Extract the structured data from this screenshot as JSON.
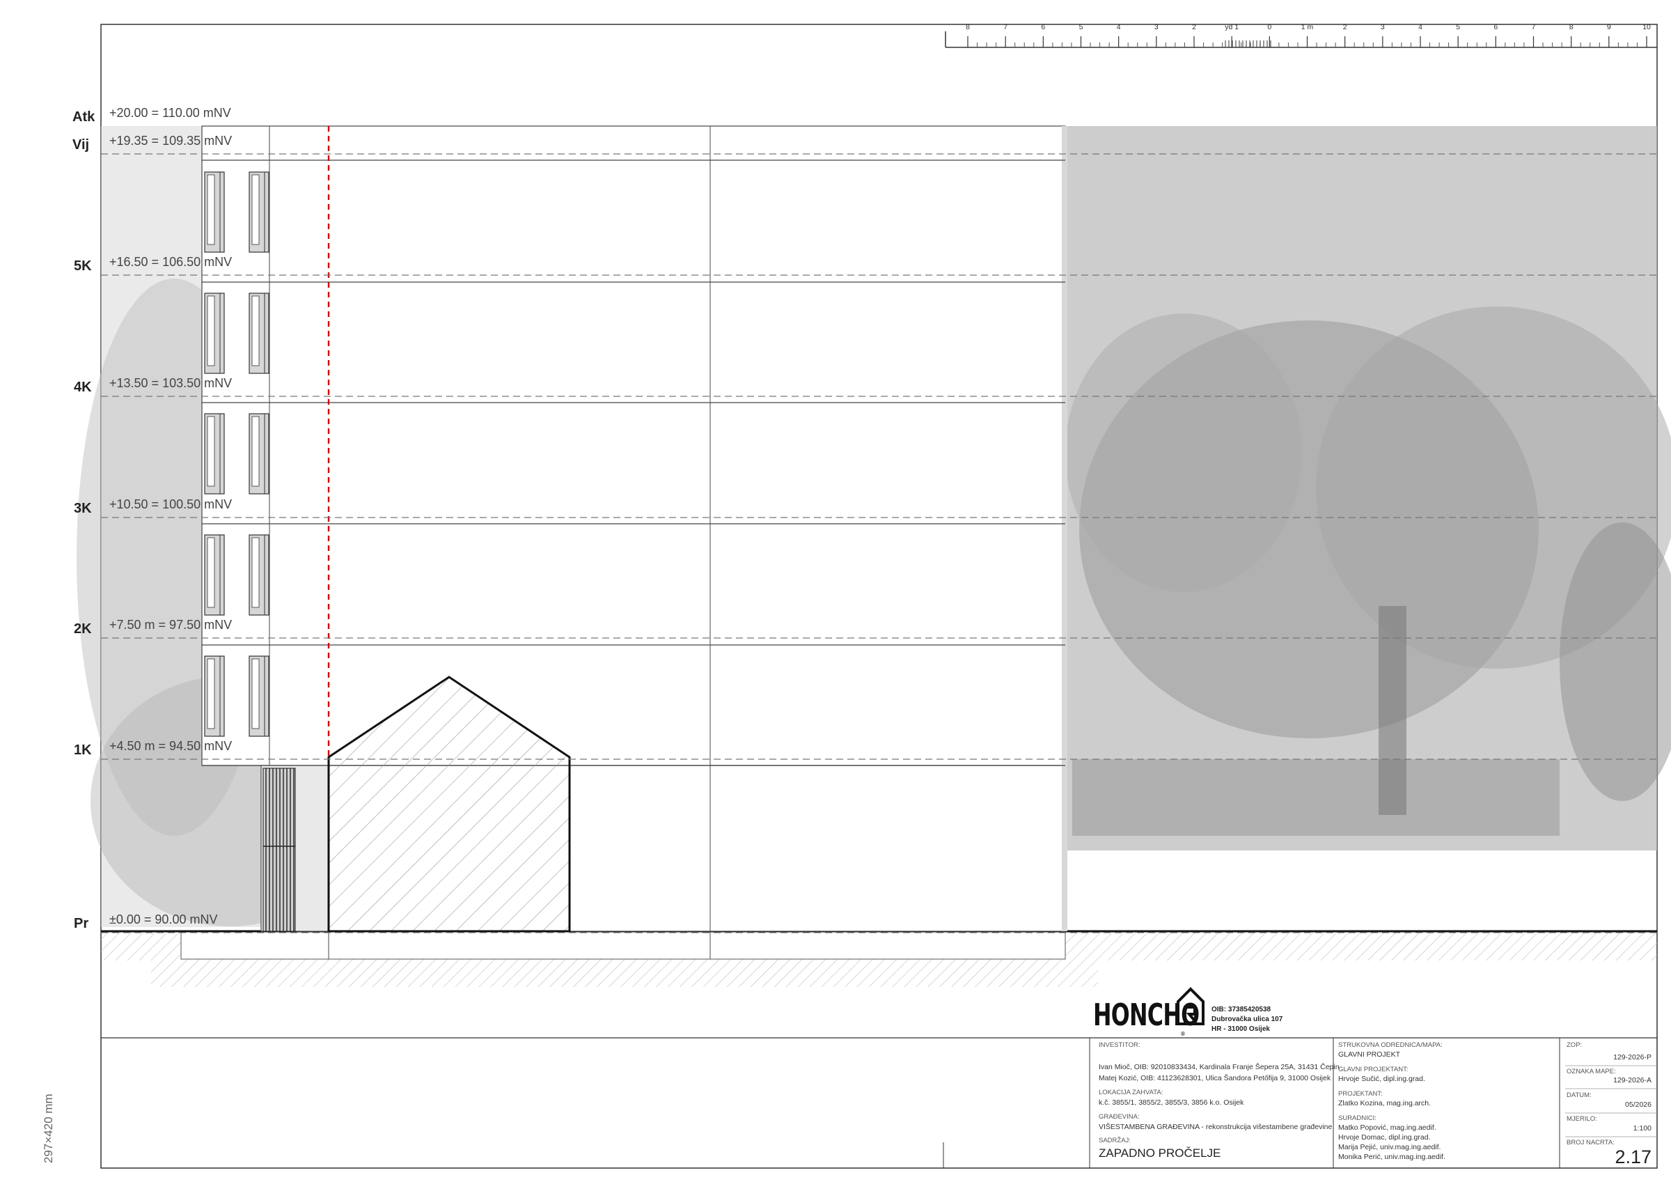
{
  "scale_bar": {
    "ticks": [
      "8",
      "7",
      "6",
      "5",
      "4",
      "3",
      "2",
      "yd 1",
      "0",
      "1 m",
      "2",
      "3",
      "4",
      "5",
      "6",
      "7",
      "8",
      "9",
      "10"
    ]
  },
  "levels": [
    {
      "code": "Atk",
      "elevation": "+20.00 = 110.00 mNV"
    },
    {
      "code": "Vij",
      "elevation": "+19.35 = 109.35 mNV"
    },
    {
      "code": "5K",
      "elevation": "+16.50 = 106.50 mNV"
    },
    {
      "code": "4K",
      "elevation": "+13.50 = 103.50 mNV"
    },
    {
      "code": "3K",
      "elevation": "+10.50 = 100.50 mNV"
    },
    {
      "code": "2K",
      "elevation": "+7.50 m = 97.50 mNV"
    },
    {
      "code": "1K",
      "elevation": "+4.50 m = 94.50 mNV"
    },
    {
      "code": "Pr",
      "elevation": "±0.00 = 90.00 mNV"
    }
  ],
  "firm": {
    "name": "HONCHO",
    "registered_mark": "®",
    "oib": "OIB: 37385420538",
    "street": "Dubrovačka ulica 107",
    "city": "HR - 31000 Osijek"
  },
  "title_block": {
    "investor_label": "INVESTITOR:",
    "investor_1": "Ivan Mioč, OIB: 92010833434, Kardinala Franje Šepera 25A, 31431 Čepin",
    "investor_2": "Matej Kozić, OIB: 41123628301, Ulica Šandora Petőfija 9, 31000 Osijek",
    "location_label": "LOKACIJA ZAHVATA:",
    "location": "k.č. 3855/1, 3855/2, 3855/3, 3856 k.o. Osijek",
    "building_label": "GRAĐEVINA:",
    "building": "VIŠESTAMBENA GRAĐEVINA - rekonstrukcija višestambene građevine",
    "content_label": "SADRŽAJ:",
    "content": "ZAPADNO PROČELJE",
    "discipline_label": "STRUKOVNA ODREDNICA/MAPA:",
    "discipline": "GLAVNI PROJEKT",
    "chief_designer_label": "GLAVNI PROJEKTANT:",
    "chief_designer": "Hrvoje Sučić, dipl.ing.grad.",
    "designer_label": "PROJEKTANT:",
    "designer": "Zlatko Kozina, mag.ing.arch.",
    "associates_label": "SURADNICI:",
    "associates": [
      "Matko Popović, mag.ing.aedif.",
      "Hrvoje Domac, dipl.ing.grad.",
      "Marija Pejić, univ.mag.ing.aedif.",
      "Monika Perić, univ.mag.ing.aedif."
    ],
    "zop_label": "ZOP:",
    "zop": "129-2026-P",
    "map_label": "OZNAKA MAPE:",
    "map": "129-2026-A",
    "date_label": "DATUM:",
    "date": "05/2026",
    "scale_label": "MJERILO:",
    "scale": "1:100",
    "sheet_label": "BROJ NACRTA:",
    "sheet": "2.17"
  },
  "paper_size": "297×420 mm"
}
